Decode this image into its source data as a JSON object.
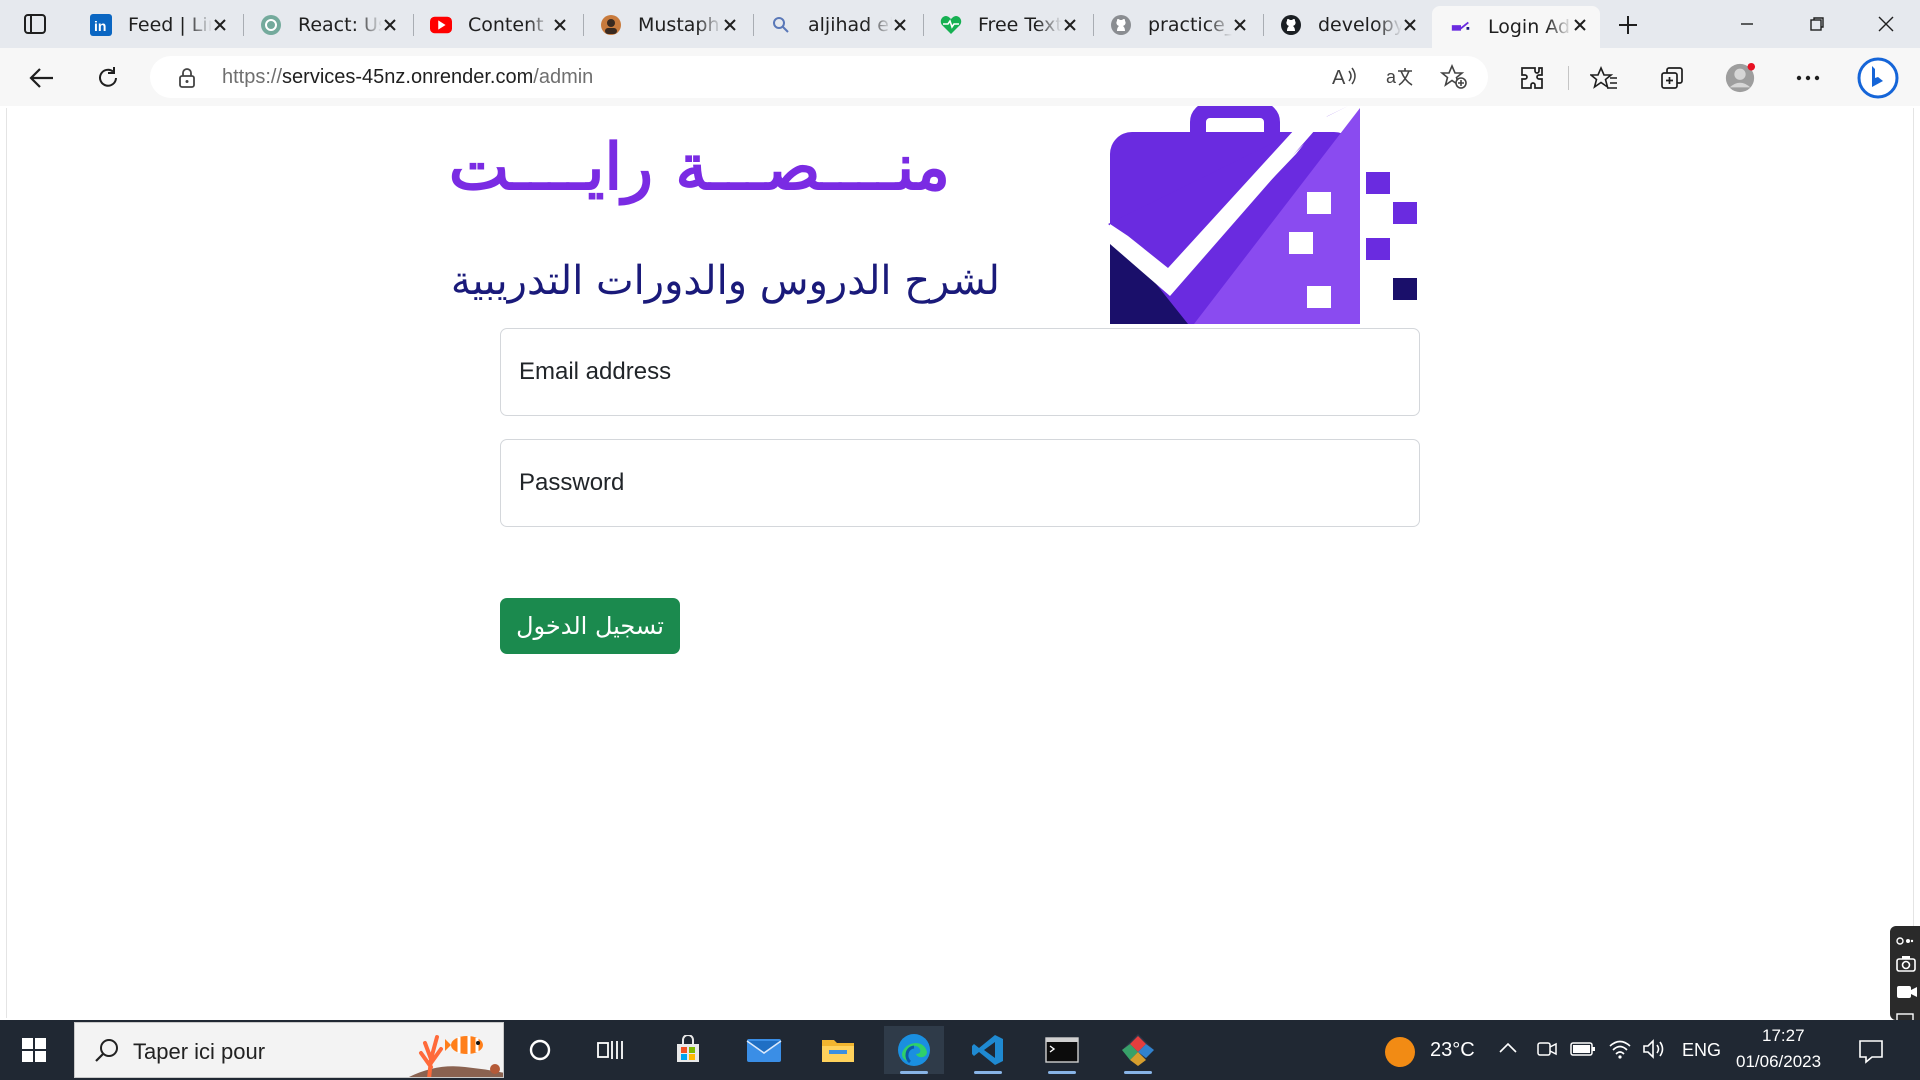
{
  "browser": {
    "tabs": [
      {
        "title": "Feed | LinkedIn",
        "icon": "linkedin-icon"
      },
      {
        "title": "React: Using",
        "icon": "chatgpt-icon"
      },
      {
        "title": "Content",
        "icon": "youtube-icon"
      },
      {
        "title": "Mustapha",
        "icon": "avatar-icon"
      },
      {
        "title": "aljihad el",
        "icon": "search-icon"
      },
      {
        "title": "Free Text",
        "icon": "heart-pulse-icon"
      },
      {
        "title": "practice_",
        "icon": "github-icon"
      },
      {
        "title": "developy",
        "icon": "github-icon"
      },
      {
        "title": "Login Admin",
        "icon": "site-logo-icon",
        "active": true
      }
    ],
    "url": {
      "scheme": "https://",
      "host": "services-45nz.onrender.com",
      "path": "/admin"
    },
    "colors": {
      "accent": "#1b8a4e",
      "brand": "#7a2be3",
      "brand_dark": "#1a1a7a",
      "bing": "#1565d8"
    }
  },
  "page": {
    "brand_title": "منــــصـــة رايــــت",
    "brand_subtitle": "لشرح الدروس والدورات التدريبية",
    "email_placeholder": "Email address",
    "password_placeholder": "Password",
    "login_label": "تسجيل الدخول"
  },
  "taskbar": {
    "search_placeholder": "Taper ici pour",
    "weather": "23°C",
    "language": "ENG",
    "time": "17:27",
    "date": "01/06/2023"
  }
}
